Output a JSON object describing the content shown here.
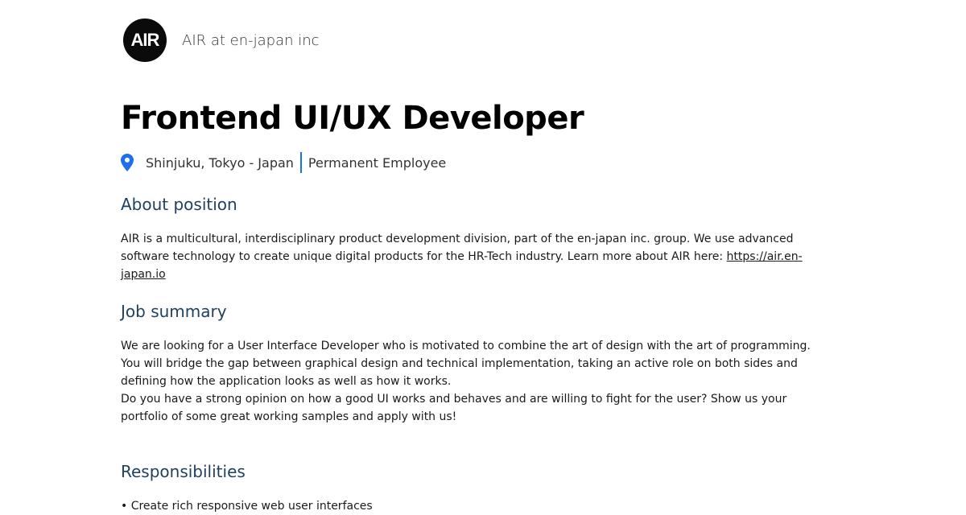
{
  "company": {
    "logo_text": "AIR",
    "name": "AIR at en-japan inc"
  },
  "job": {
    "title": "Frontend UI/UX Developer",
    "location": "Shinjuku, Tokyo - Japan",
    "employment_type": "Permanent Employee"
  },
  "icons": {
    "location": "location-pin-icon"
  },
  "colors": {
    "accent": "#1e6ef0",
    "heading": "#1f3f5f",
    "logo_bg": "#0b0b0b"
  },
  "sections": {
    "about": {
      "heading": "About position",
      "text": "AIR is a multicultural, interdisciplinary product development division, part of the en-japan inc. group. We use advanced software technology to create unique digital products for the HR-Tech industry. Learn more about AIR here: ",
      "link": "https://air.en-japan.io"
    },
    "summary": {
      "heading": "Job summary",
      "paragraph1": "We are looking for a User Interface Developer who is motivated to combine the art of design with the art of programming. You will bridge the gap between graphical design and technical implementation, taking an active role on both sides and defining how the application looks as well as how it works.",
      "paragraph2": "Do you have a strong opinion on how a good UI works and behaves and are willing to fight for the user? Show us your portfolio of some great working samples and apply with us!"
    },
    "responsibilities": {
      "heading": "Responsibilities",
      "items": [
        "• Create rich responsive web user interfaces"
      ]
    }
  }
}
